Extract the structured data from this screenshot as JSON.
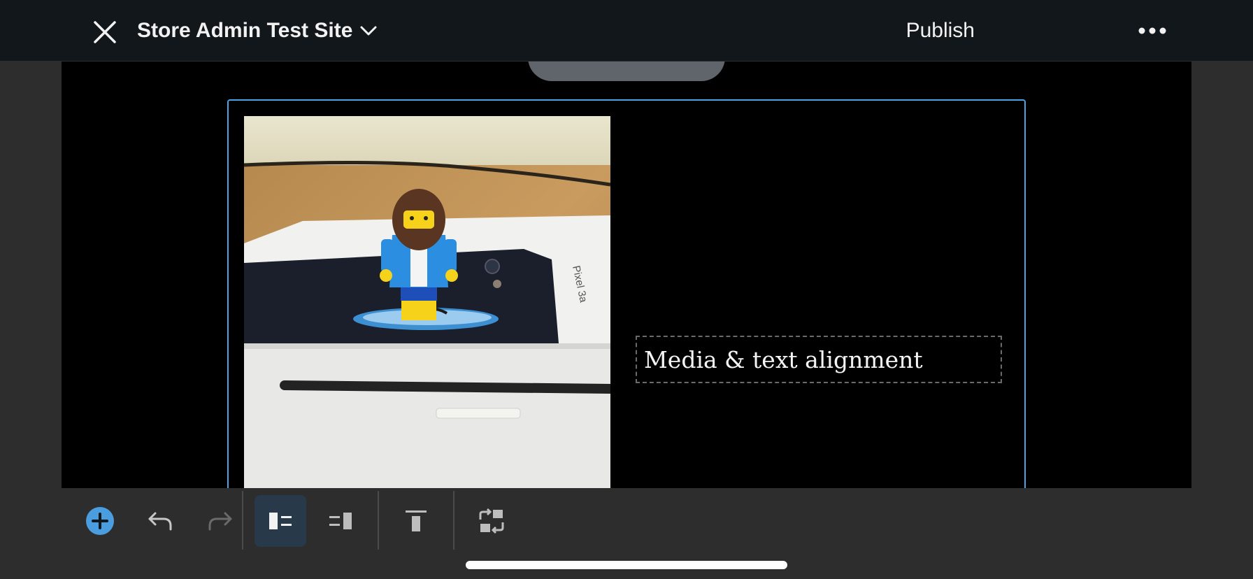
{
  "header": {
    "site_title": "Store Admin Test Site",
    "publish_label": "Publish",
    "close_icon": "close-icon",
    "chevron_icon": "chevron-down-icon",
    "more_icon": "more-horizontal-icon"
  },
  "block": {
    "heading_text": "Media & text alignment",
    "media_alt_icon": "photo",
    "image_label": "Pixel 3a"
  },
  "toolbar": {
    "items": [
      {
        "icon": "add-block-icon"
      },
      {
        "icon": "undo-icon"
      },
      {
        "icon": "redo-icon"
      },
      {
        "icon": "media-left-icon",
        "active": true
      },
      {
        "icon": "media-right-icon"
      },
      {
        "icon": "align-top-icon"
      },
      {
        "icon": "transform-block-icon"
      }
    ]
  },
  "colors": {
    "accent": "#4aa3e8",
    "topbar": "#12171b",
    "canvas": "#000000",
    "toolbar": "#2d2d2d"
  }
}
